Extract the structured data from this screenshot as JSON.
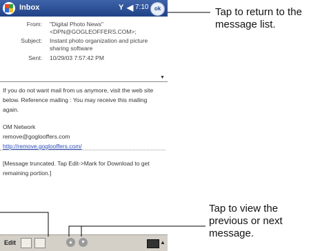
{
  "titlebar": {
    "title": "Inbox",
    "signal_glyph": "Y",
    "speaker_glyph": "◀",
    "clock": "7:10",
    "ok_label": "ok"
  },
  "header": {
    "from_label": "From:",
    "from_value": "\"Digital Photo News\" <DPN@GOGLEOFFERS.COM>;",
    "subject_label": "Subject:",
    "subject_value": "Instant photo organization and picture sharing software",
    "sent_label": "Sent:",
    "sent_value": "10/29/03 7:57:42 PM",
    "scroll_glyph": "▼"
  },
  "body": {
    "paragraph1": "If you do not want mail from us anymore, visit the web site below. Reference mailing : You may receive this mailing again.",
    "network": "OM Network",
    "email": "remove@goglooffers.com",
    "link": "http://remove.goglooffers.com/",
    "truncated": "[Message truncated. Tap Edit->Mark for Download to get remaining portion.]"
  },
  "toolbar": {
    "edit_label": "Edit",
    "prev_glyph": "▲",
    "next_glyph": "▼",
    "keyboard_arrow": "▲"
  },
  "callouts": {
    "top": "Tap to return to the message list.",
    "bottom": "Tap to view the previous or next message."
  },
  "colors": {
    "titlebar": "#1f4287",
    "toolbar": "#d4d0c8",
    "link": "#2a4bb5"
  }
}
